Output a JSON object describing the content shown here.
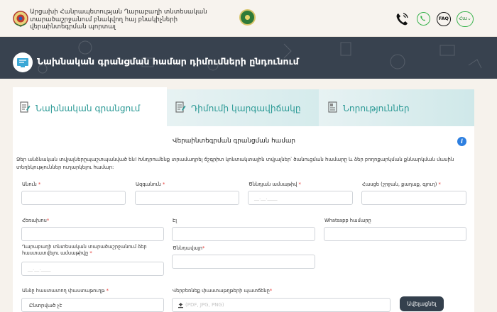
{
  "header": {
    "org_name": "Արցախի Հանրապետության Ղարաբաղի տնտեսական տարածաշրջանում բնակվող հայ բնակիչների վերաինտեգրման պորտալ",
    "faq_label": "FAQ",
    "lang_label": "Հա"
  },
  "banner": {
    "title": "Նախնական գրանցման համար դիմումների ընդունում"
  },
  "tabs": [
    {
      "label": "Նախնական գրանցում",
      "active": true
    },
    {
      "label": "Դիմումի կարգավիճակը",
      "active": false
    },
    {
      "label": "Նորություններ",
      "active": false
    }
  ],
  "form": {
    "title": "Վերաինտեգրման գրանցման համար",
    "info_icon_glyph": "i",
    "intro": "Ձեր անձնական տվյալներըպաշտպանված են! Խնդրումենք տրամադրել ճշգրիտ կոնտակտային տվյալներ՝ ծանուցման համարը և ձեր բողոքարկման քննարկման մասին տեղեկություններ ուղարկելու համար:",
    "fields": {
      "first_name": {
        "label": "Անուն",
        "required": true
      },
      "last_name": {
        "label": "Ազգանուն",
        "required": true
      },
      "birth_date": {
        "label": "Ծննդյան ամսաթիվ",
        "required": true,
        "placeholder": "__.__.____"
      },
      "address": {
        "label": "Հասցե (շրջան, քաղաք, գյուղ)",
        "required": true
      },
      "phone": {
        "label": "Հեռախոս",
        "required": true
      },
      "email": {
        "label": "Էլ",
        "required": false
      },
      "whatsapp": {
        "label": "Whatsapp համարը",
        "required": false
      },
      "residence_date": {
        "label": "Ղարաբաղի տնտեսական տարածաշրջանում ձեր հաստատվելու ամսաթիվը",
        "required": true,
        "placeholder": "__.__.____"
      },
      "birthplace": {
        "label": "Ծննդավայր",
        "required": true
      },
      "id_document": {
        "label": "Անձը հաստատող փաստաթուղթ",
        "required": true,
        "value": "Ընտրված չէ"
      },
      "attachments": {
        "label": "Վերբեռնեք փաստաթղթերի պատճենը",
        "required": true,
        "placeholder": "(PDF, JPG, PNG)"
      }
    },
    "add_button": "Ավելացնել"
  },
  "colors": {
    "accent_teal": "#2c9a96",
    "banner_bg": "#38424f",
    "required_star": "#e53935",
    "whatsapp_green": "#36b24a",
    "info_blue": "#2d7fe0"
  },
  "icons": [
    "emblem-icon",
    "logo-icon",
    "phone-icon",
    "whatsapp-icon",
    "faq-icon",
    "language-icon",
    "monitor-icon",
    "form-icon",
    "status-icon",
    "news-icon",
    "info-icon",
    "upload-icon"
  ]
}
